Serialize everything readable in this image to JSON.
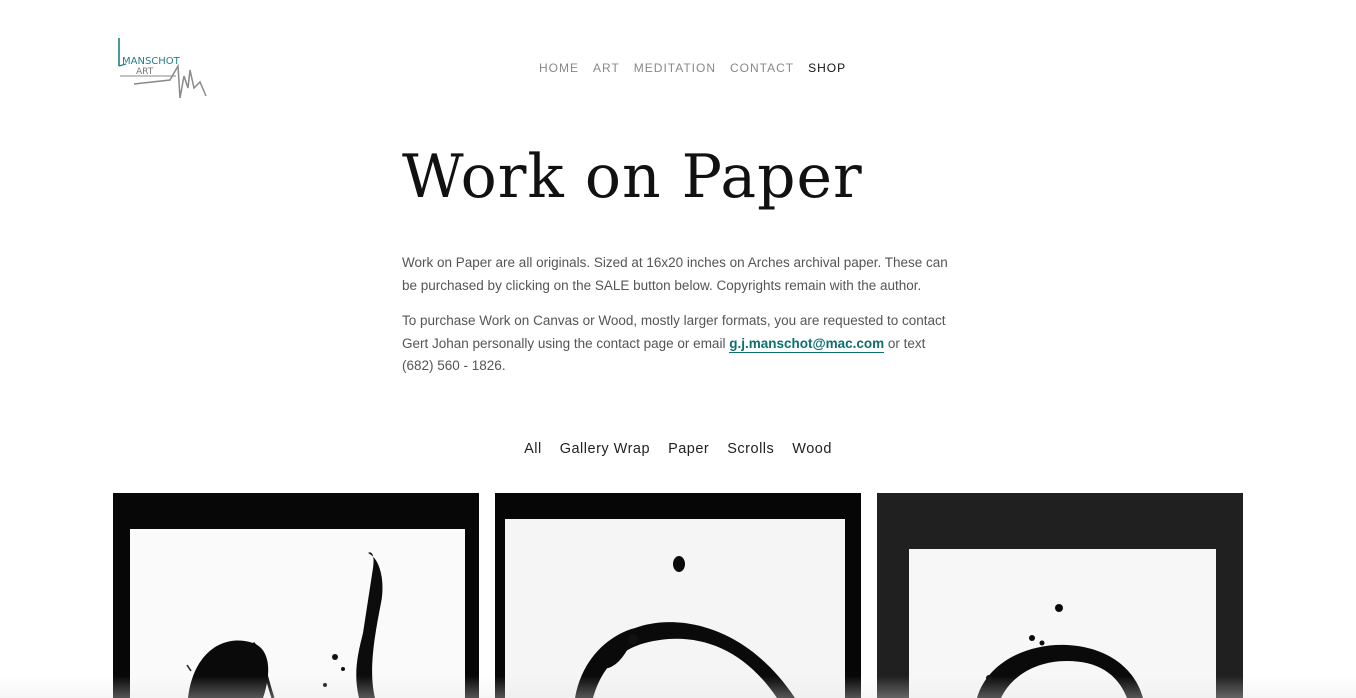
{
  "header": {
    "logo": {
      "text_top": "MANSCHOT",
      "text_bottom": "ART",
      "icon": "manschot-art-logo"
    },
    "nav": [
      {
        "label": "HOME",
        "active": false
      },
      {
        "label": "ART",
        "active": false
      },
      {
        "label": "MEDITATION",
        "active": false
      },
      {
        "label": "CONTACT",
        "active": false
      },
      {
        "label": "SHOP",
        "active": true
      }
    ]
  },
  "page": {
    "title": "Work on Paper",
    "intro_1": "Work on Paper are all originals. Sized at 16x20 inches on Arches archival paper. These can be purchased by clicking on the SALE button below. Copyrights remain with the author.",
    "intro_2_before": "To purchase Work on Canvas or Wood, mostly larger formats, you are requested to contact Gert Johan personally using the contact page or email ",
    "email": "g.j.manschot@mac.com",
    "intro_2_after": " or text (682) 560 - 1826."
  },
  "filters": [
    {
      "label": "All"
    },
    {
      "label": "Gallery Wrap"
    },
    {
      "label": "Paper"
    },
    {
      "label": "Scrolls"
    },
    {
      "label": "Wood"
    }
  ],
  "gallery": {
    "items": [
      {
        "name": "ink-brush-artwork-1"
      },
      {
        "name": "ink-brush-artwork-2"
      },
      {
        "name": "ink-brush-artwork-3"
      }
    ]
  },
  "colors": {
    "accent": "#0f6f6f",
    "logo_teal": "#1f7f86",
    "text": "#555555",
    "nav_muted": "#888888"
  }
}
